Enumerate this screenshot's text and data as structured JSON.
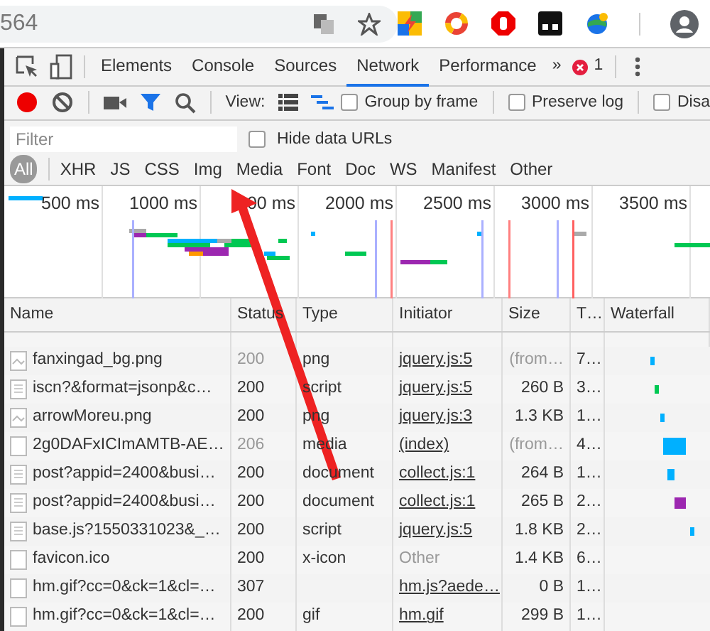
{
  "address_bar": {
    "text": "564"
  },
  "devtools": {
    "tabs": [
      {
        "label": "Elements",
        "selected": false
      },
      {
        "label": "Console",
        "selected": false
      },
      {
        "label": "Sources",
        "selected": false
      },
      {
        "label": "Network",
        "selected": true
      },
      {
        "label": "Performance",
        "selected": false
      }
    ],
    "overflow": "»",
    "error_count": "1",
    "toolbar": {
      "recording": true,
      "filter_open": true,
      "view_label": "View:",
      "checkboxes": [
        {
          "label": "Group by frame",
          "checked": false
        },
        {
          "label": "Preserve log",
          "checked": false
        },
        {
          "label": "Disa",
          "checked": false
        }
      ]
    },
    "filter": {
      "placeholder": "Filter",
      "hide_data_urls": {
        "label": "Hide data URLs",
        "checked": false
      }
    },
    "type_filters": [
      {
        "label": "All",
        "selected": true
      },
      {
        "label": "XHR",
        "selected": false
      },
      {
        "label": "JS",
        "selected": false
      },
      {
        "label": "CSS",
        "selected": false
      },
      {
        "label": "Img",
        "selected": false
      },
      {
        "label": "Media",
        "selected": false
      },
      {
        "label": "Font",
        "selected": false
      },
      {
        "label": "Doc",
        "selected": false
      },
      {
        "label": "WS",
        "selected": false
      },
      {
        "label": "Manifest",
        "selected": false
      },
      {
        "label": "Other",
        "selected": false
      }
    ],
    "overview": {
      "tick_labels": [
        "500 ms",
        "1000 ms",
        "00 ms",
        "2000 ms",
        "2500 ms",
        "3000 ms",
        "3500 ms"
      ]
    },
    "table": {
      "columns": [
        "Name",
        "Status",
        "Type",
        "Initiator",
        "Size",
        "T…",
        "Waterfall"
      ],
      "rows": [
        {
          "kind": "image",
          "name": "fanxingad_bg.png",
          "status": "200",
          "type": "png",
          "initiator": "jquery.js:5",
          "initiator_link": true,
          "size": "(from…",
          "time": "7…",
          "cached": true
        },
        {
          "kind": "document",
          "name": "iscn?&format=jsonp&c…",
          "status": "200",
          "type": "script",
          "initiator": "jquery.js:5",
          "initiator_link": true,
          "size": "260 B",
          "time": "3…",
          "cached": false
        },
        {
          "kind": "image",
          "name": "arrowMoreu.png",
          "status": "200",
          "type": "png",
          "initiator": "jquery.js:3",
          "initiator_link": true,
          "size": "1.3 KB",
          "time": "1…",
          "cached": false
        },
        {
          "kind": "blank",
          "name": "2g0DAFxICImAMTB-AE…",
          "status": "206",
          "type": "media",
          "initiator": "(index)",
          "initiator_link": true,
          "size": "(from…",
          "time": "4…",
          "cached": true
        },
        {
          "kind": "document",
          "name": "post?appid=2400&busi…",
          "status": "200",
          "type": "document",
          "initiator": "collect.js:1",
          "initiator_link": true,
          "size": "264 B",
          "time": "1…",
          "cached": false
        },
        {
          "kind": "document",
          "name": "post?appid=2400&busi…",
          "status": "200",
          "type": "document",
          "initiator": "collect.js:1",
          "initiator_link": true,
          "size": "265 B",
          "time": "2…",
          "cached": false
        },
        {
          "kind": "document",
          "name": "base.js?1550331023&_…",
          "status": "200",
          "type": "script",
          "initiator": "jquery.js:5",
          "initiator_link": true,
          "size": "1.8 KB",
          "time": "2…",
          "cached": false
        },
        {
          "kind": "blank",
          "name": "favicon.ico",
          "status": "200",
          "type": "x-icon",
          "initiator": "Other",
          "initiator_link": false,
          "size": "1.4 KB",
          "time": "6…",
          "cached": false
        },
        {
          "kind": "blank",
          "name": "hm.gif?cc=0&ck=1&cl=…",
          "status": "307",
          "initiator": "hm.js?aede…",
          "initiator_link": true,
          "size": "0 B",
          "time": "1…",
          "cached": false
        },
        {
          "kind": "blank",
          "name": "hm.gif?cc=0&ck=1&cl=…",
          "status": "200",
          "type": "gif",
          "initiator": "hm.gif",
          "initiator_link": true,
          "size": "299 B",
          "time": "1…",
          "cached": false
        }
      ]
    }
  }
}
